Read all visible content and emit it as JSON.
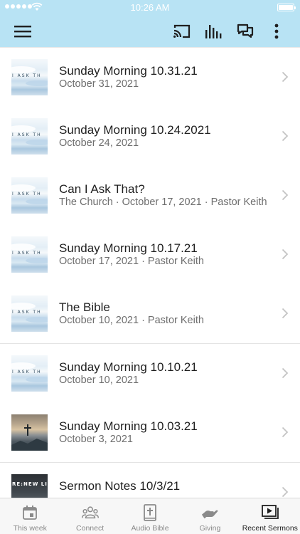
{
  "status_bar": {
    "time": "10:26 AM"
  },
  "sermons": [
    {
      "title": "Sunday Morning 10.31.21",
      "subtitle": "October 31, 2021",
      "thumb_text": "I  ASK  TH",
      "thumb_kind": "clouds"
    },
    {
      "title": "Sunday Morning 10.24.2021",
      "subtitle": "October 24, 2021",
      "thumb_text": "I  ASK  TH",
      "thumb_kind": "clouds"
    },
    {
      "title": "Can I Ask That?",
      "subtitle": "The Church · October 17, 2021 · Pastor Keith",
      "thumb_text": "I  ASK  TH",
      "thumb_kind": "clouds"
    },
    {
      "title": "Sunday Morning 10.17.21",
      "subtitle": "October 17, 2021 · Pastor Keith",
      "thumb_text": "I  ASK  TH",
      "thumb_kind": "clouds"
    },
    {
      "title": "The Bible",
      "subtitle": "October 10, 2021 · Pastor Keith",
      "thumb_text": "I  ASK  TH",
      "thumb_kind": "clouds"
    },
    {
      "title": "Sunday Morning 10.10.21",
      "subtitle": "October 10, 2021",
      "thumb_text": "I  ASK  TH",
      "thumb_kind": "clouds"
    },
    {
      "title": "Sunday Morning 10.03.21",
      "subtitle": "October 3, 2021",
      "thumb_text": "",
      "thumb_kind": "photo"
    },
    {
      "title": "Sermon Notes 10/3/21",
      "subtitle": "",
      "thumb_text": "RE:NEW LIFE",
      "thumb_kind": "dark"
    }
  ],
  "tabs": [
    {
      "label": "This week",
      "icon": "calendar-icon",
      "active": false
    },
    {
      "label": "Connect",
      "icon": "people-icon",
      "active": false
    },
    {
      "label": "Audio Bible",
      "icon": "bible-icon",
      "active": false
    },
    {
      "label": "Giving",
      "icon": "giving-hand-icon",
      "active": false
    },
    {
      "label": "Recent Sermons",
      "icon": "play-video-icon",
      "active": true
    }
  ],
  "colors": {
    "header_bg": "#b8e3f4",
    "icon_dark": "#1f1f1f",
    "subtitle": "#6e6e6e",
    "tab_inactive": "#8a8a8a"
  }
}
